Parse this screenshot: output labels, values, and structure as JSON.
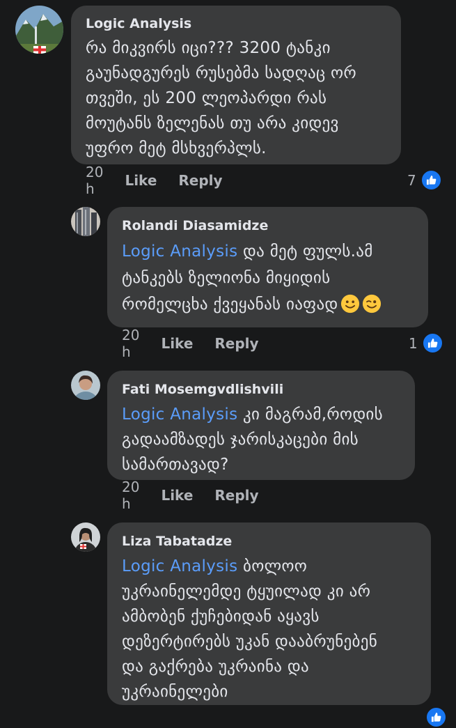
{
  "comments": [
    {
      "author": "Logic Analysis",
      "text_lines": [
        "რა მიკვირს იცი??? 3200 ტანკი",
        "გაუნადგურეს რუსებმა სადღაც ორ",
        "თვეში, ეს 200 ლეოპარდი რას",
        "მოუტანს ზელენას თუ არა კიდევ",
        "უფრო მეტ მსხვერპლს."
      ],
      "time": "20 h",
      "like_label": "Like",
      "reply_label": "Reply",
      "reaction_count": "7"
    },
    {
      "author": "Rolandi Diasamidze",
      "mention": "Logic Analysis",
      "text_first": " და მეტ ფულს.ამ",
      "text_lines": [
        "ტანკებს ზელიონა მიყიდის",
        "რომელცხა ქვეყანას იაფად"
      ],
      "time": "20 h",
      "like_label": "Like",
      "reply_label": "Reply",
      "reaction_count": "1"
    },
    {
      "author": "Fati Mosemgvdlishvili",
      "mention": "Logic Analysis",
      "text_first": " კი მაგრამ,როდის",
      "text_lines": [
        "გადაამზადეს ჯარისკაცები მის",
        "სამართავად?"
      ],
      "time": "20 h",
      "like_label": "Like",
      "reply_label": "Reply"
    },
    {
      "author": "Liza Tabatadze",
      "mention": "Logic Analysis",
      "text_first": " ბოლოო",
      "text_lines": [
        "უკრაინელემდე ტყუილად კი არ",
        "ამბობენ ქუჩებიდან აყავს",
        "დეზერტირებს უკან დააბრუნებენ",
        "და გაქრება უკრაინა და",
        "უკრაინელები"
      ]
    }
  ]
}
